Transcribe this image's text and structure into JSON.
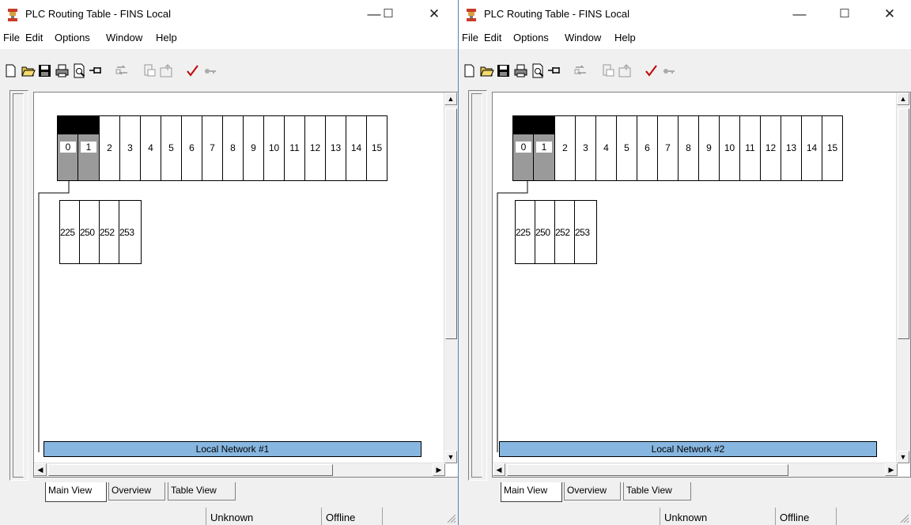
{
  "windows": [
    {
      "title": "PLC Routing Table - FINS Local",
      "menu": [
        "File",
        "Edit",
        "Options",
        "Window",
        "Help"
      ],
      "node_numbers": [
        "0",
        "1",
        "2",
        "3",
        "4",
        "5",
        "6",
        "7",
        "8",
        "9",
        "10",
        "11",
        "12",
        "13",
        "14",
        "15"
      ],
      "sub_nodes": [
        "225",
        "250",
        "252",
        "253"
      ],
      "network_label": "Local Network #1",
      "tabs": [
        "Main View",
        "Overview",
        "Table View"
      ],
      "active_tab": "Main View",
      "status": {
        "connection": "Unknown",
        "mode": "Offline"
      }
    },
    {
      "title": "PLC Routing Table - FINS Local",
      "menu": [
        "File",
        "Edit",
        "Options",
        "Window",
        "Help"
      ],
      "node_numbers": [
        "0",
        "1",
        "2",
        "3",
        "4",
        "5",
        "6",
        "7",
        "8",
        "9",
        "10",
        "11",
        "12",
        "13",
        "14",
        "15"
      ],
      "sub_nodes": [
        "225",
        "250",
        "252",
        "253"
      ],
      "network_label": "Local Network #2",
      "tabs": [
        "Main View",
        "Overview",
        "Table View"
      ],
      "active_tab": "Main View",
      "status": {
        "connection": "Unknown",
        "mode": "Offline"
      }
    }
  ],
  "window_controls": [
    "minimize-icon",
    "maximize-icon",
    "close-icon"
  ],
  "toolbar_icons": [
    "new-file-icon",
    "open-folder-icon",
    "save-icon",
    "print-icon",
    "print-preview-icon",
    "pin-icon",
    "transfer-icon",
    "upload-icon",
    "download-icon",
    "check-icon",
    "key-icon"
  ],
  "colors": {
    "network_bar": "#87b7e0",
    "node_filled": "#9a9a9a",
    "window_border": "#5a7fb0"
  }
}
